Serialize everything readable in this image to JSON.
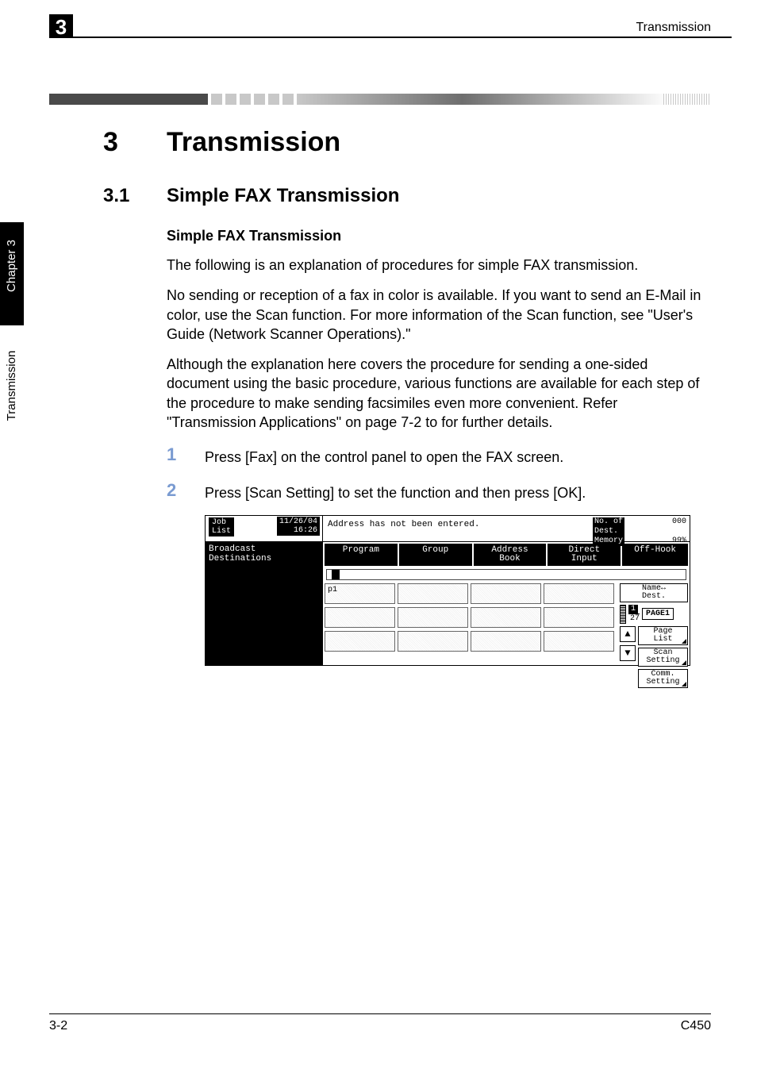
{
  "header": {
    "chapter_badge": "3",
    "running_head": "Transmission"
  },
  "side_tab": {
    "chapter_label": "Chapter 3",
    "section_label": "Transmission"
  },
  "headings": {
    "h1_num": "3",
    "h1_text": "Transmission",
    "h2_num": "3.1",
    "h2_text": "Simple FAX Transmission",
    "h3_text": "Simple FAX Transmission"
  },
  "paragraphs": {
    "p1": "The following is an explanation of procedures for simple FAX transmission.",
    "p2": "No sending or reception of a fax in color is available. If you want to send an E-Mail in color, use the Scan function. For more information of the Scan function, see \"User's Guide (Network Scanner Operations).\"",
    "p3": "Although the explanation here covers the procedure for sending a one-sided document using the basic procedure, various functions are available for each step of the procedure to make sending facsimiles even more convenient. Refer \"Transmission Applications\" on page 7-2 to for further details."
  },
  "steps": {
    "s1_num": "1",
    "s1_text": "Press [Fax] on the control panel to open the FAX screen.",
    "s2_num": "2",
    "s2_text": "Press [Scan Setting] to set the function and then press [OK]."
  },
  "fax_screen": {
    "job_list_label": "Job\nList",
    "datetime_line1": "11/26/04",
    "datetime_line2": "16:26",
    "status_message": "Address has not been entered.",
    "dest_label": "No. of\nDest.",
    "dest_count": "000",
    "memory_label": "Memory",
    "memory_value": "99%",
    "broadcast_label": "Broadcast\nDestinations",
    "tabs": {
      "program": "Program",
      "group": "Group",
      "address_book": "Address\nBook",
      "direct_input": "Direct\nInput",
      "off_hook": "Off-Hook"
    },
    "cell_p1": "p1",
    "name_dest": "Name↔\nDest.",
    "pager_cur": "1",
    "pager_total": "27",
    "page_label": "PAGE1",
    "page_list": "Page\nList",
    "scan_setting": "Scan\nSetting",
    "comm_setting": "Comm.\nSetting"
  },
  "footer": {
    "left": "3-2",
    "right": "C450"
  }
}
